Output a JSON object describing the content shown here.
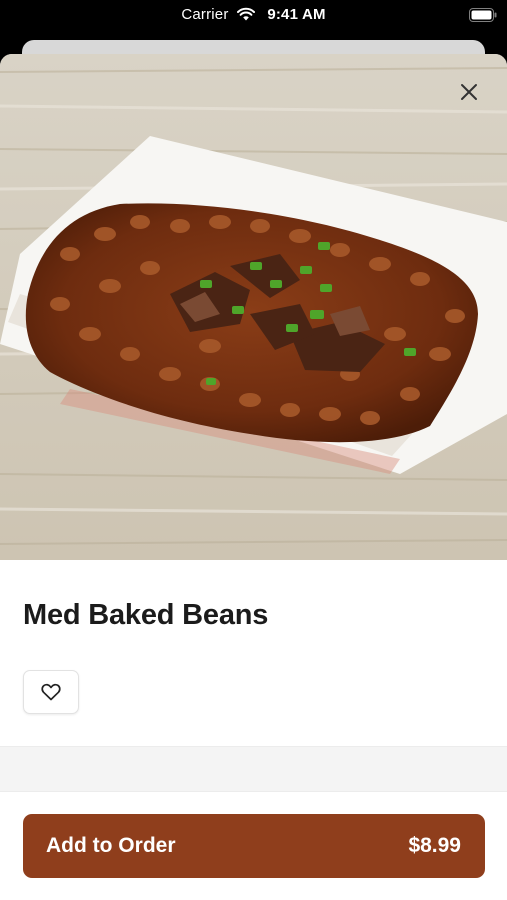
{
  "status_bar": {
    "carrier": "Carrier",
    "time": "9:41 AM",
    "wifi_icon": "wifi-icon",
    "battery_icon": "battery-icon"
  },
  "item": {
    "title": "Med Baked Beans",
    "image_icon": "baked-beans-photo"
  },
  "actions": {
    "close_icon": "close-icon",
    "favorite_icon": "heart-icon",
    "add_label": "Add to Order",
    "price": "$8.99"
  },
  "colors": {
    "accent": "#8f3e1c",
    "title": "#1b1b1b",
    "band": "#f4f4f4"
  }
}
